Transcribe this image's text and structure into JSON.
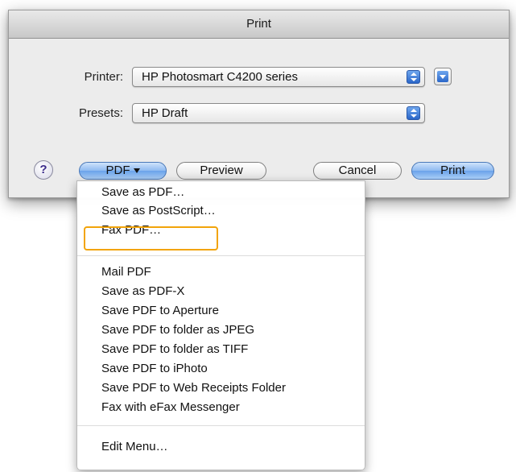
{
  "window": {
    "title": "Print"
  },
  "printer": {
    "label": "Printer:",
    "selected": "HP Photosmart C4200 series"
  },
  "presets": {
    "label": "Presets:",
    "selected": "HP Draft"
  },
  "buttons": {
    "help": "?",
    "pdf": "PDF",
    "preview": "Preview",
    "cancel": "Cancel",
    "print": "Print"
  },
  "pdf_menu": {
    "items": [
      "Save as PDF…",
      "Save as PostScript…",
      "Fax PDF…",
      "Mail PDF",
      "Save as PDF-X",
      "Save PDF to Aperture",
      "Save PDF to folder as JPEG",
      "Save PDF to folder as TIFF",
      "Save PDF to iPhoto",
      "Save PDF to Web Receipts Folder",
      "Fax with eFax Messenger",
      "Edit Menu…"
    ],
    "highlighted_item": "Fax PDF…"
  },
  "colors": {
    "accent_blue": "#4f8fe6",
    "highlight_outline": "#f2a40a",
    "window_bg": "#ececec"
  },
  "icons": {
    "stepper": "up-down-arrows-icon",
    "disclosure": "disclosure-triangle-icon",
    "help": "question-mark-icon"
  }
}
